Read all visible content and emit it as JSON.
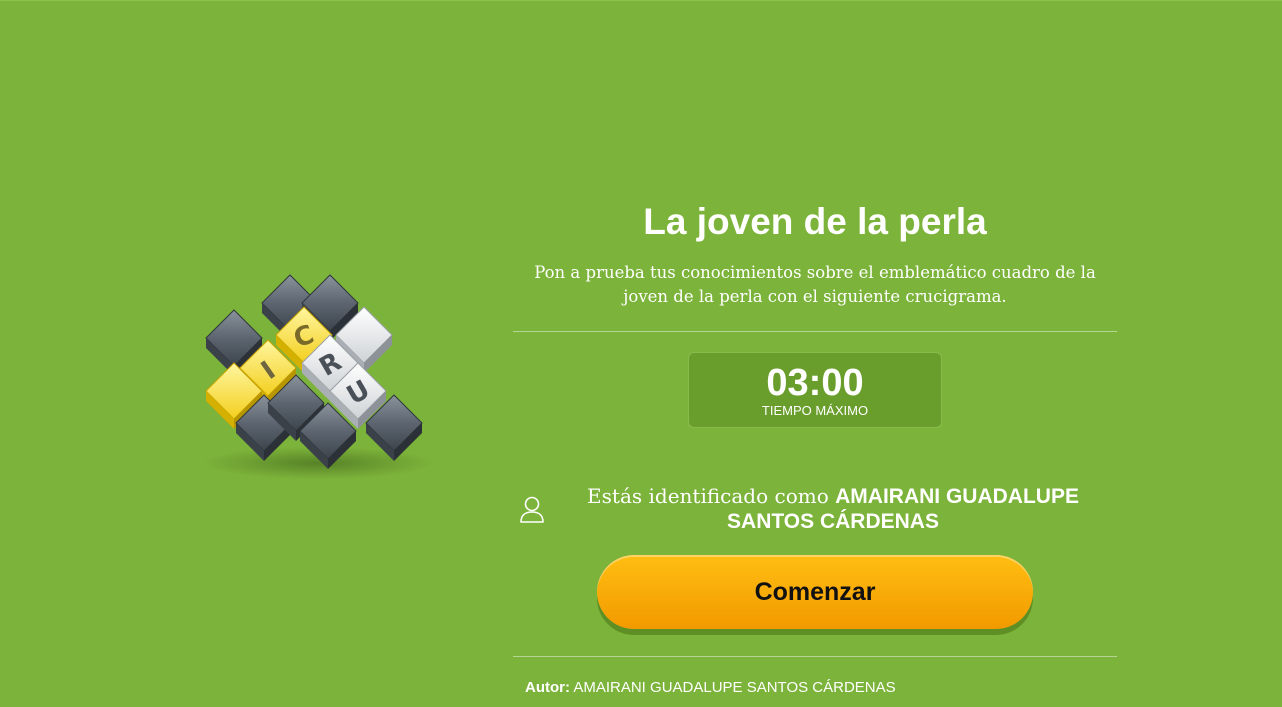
{
  "quiz": {
    "title": "La joven de la perla",
    "description": "Pon a prueba tus conocimientos sobre el emblemático cuadro de la joven de la perla con el siguiente crucigrama."
  },
  "logo": {
    "letters": [
      "C",
      "I",
      "R",
      "U"
    ],
    "icon": "crossword-logo-icon"
  },
  "timer": {
    "value": "03:00",
    "label": "TIEMPO MÁXIMO"
  },
  "user": {
    "icon": "user-icon",
    "prefix": "Estás identificado como",
    "name": "AMAIRANI GUADALUPE SANTOS CÁRDENAS"
  },
  "actions": {
    "start_label": "Comenzar"
  },
  "author": {
    "label": "Autor:",
    "name": "AMAIRANI GUADALUPE SANTOS CÁRDENAS"
  },
  "colors": {
    "background": "#7cb33a",
    "timer_box": "#6a9e2c",
    "button": "#f7a800",
    "yellow_tile": "#f6e04a",
    "white_tile": "#eeeeee",
    "dark_tile": "#5b6570"
  }
}
